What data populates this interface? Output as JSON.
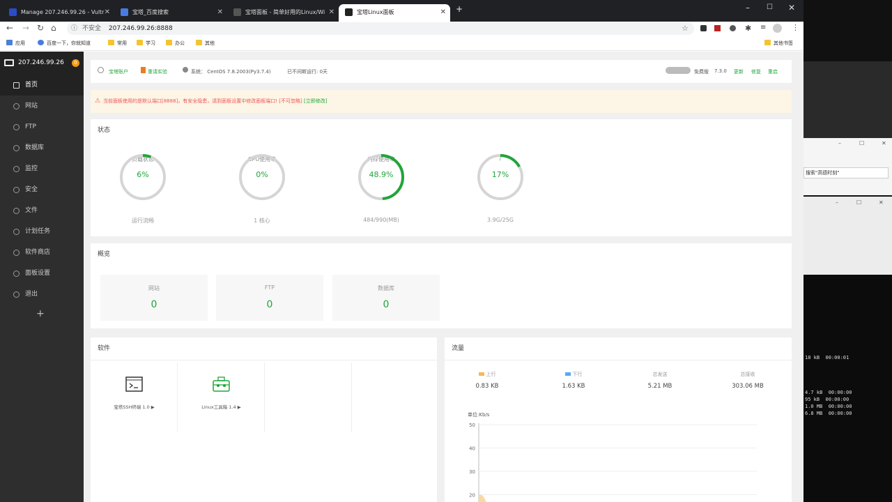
{
  "browser": {
    "tabs": [
      {
        "title": "Manage 207.246.99.26 - Vultr",
        "icon_color": "#2b4cc7"
      },
      {
        "title": "宝塔_百度搜索",
        "icon_color": "#4a7be0"
      },
      {
        "title": "宝塔面板 - 简单好用的Linux/Wi",
        "icon_color": "#333"
      },
      {
        "title": "宝塔Linux面板",
        "icon_color": "#333"
      }
    ],
    "address_security": "不安全",
    "address_url": "207.246.99.26:8888",
    "bookmarks": [
      "应用",
      "百度一下，你就知道",
      "常用",
      "学习",
      "办公",
      "其他"
    ],
    "other_bookmarks": "其他书签"
  },
  "sidebar": {
    "server_ip": "207.246.99.26",
    "badge": "0",
    "items": [
      {
        "label": "首页",
        "icon": "home-icon"
      },
      {
        "label": "网站",
        "icon": "globe-icon"
      },
      {
        "label": "FTP",
        "icon": "ftp-icon"
      },
      {
        "label": "数据库",
        "icon": "database-icon"
      },
      {
        "label": "监控",
        "icon": "monitor-icon"
      },
      {
        "label": "安全",
        "icon": "shield-icon"
      },
      {
        "label": "文件",
        "icon": "folder-icon"
      },
      {
        "label": "计划任务",
        "icon": "clock-icon"
      },
      {
        "label": "软件商店",
        "icon": "store-icon"
      },
      {
        "label": "面板设置",
        "icon": "gear-icon"
      },
      {
        "label": "退出",
        "icon": "logout-icon"
      }
    ],
    "add": "+"
  },
  "topbar": {
    "account": "宝塔账户",
    "notice": "重请实验",
    "system": "系统：  CentOS 7.8.2003(Py3.7.4)",
    "uptime": "已不间断运行: 0天",
    "edition": "免费版",
    "version": "7.3.0",
    "update": "更新",
    "repair": "修复",
    "restart": "重启"
  },
  "warning": {
    "text": "当前面板使用的是默认端口[8888]，有安全隐患，请到面板设置中修改面板端口! [不可忽略]",
    "link": "[立即修改]"
  },
  "status": {
    "title": "状态",
    "gauges": [
      {
        "label": "负载状态",
        "value": "6%",
        "percent": 6,
        "sub": "运行流畅"
      },
      {
        "label": "CPU使用率",
        "value": "0%",
        "percent": 0,
        "sub": "1 核心"
      },
      {
        "label": "内存使用率",
        "value": "48.9%",
        "percent": 48.9,
        "sub": "484/990(MB)"
      },
      {
        "label": "/",
        "value": "17%",
        "percent": 17,
        "sub": "3.9G/25G"
      }
    ]
  },
  "overview": {
    "title": "概览",
    "cards": [
      {
        "label": "网站",
        "value": "0"
      },
      {
        "label": "FTP",
        "value": "0"
      },
      {
        "label": "数据库",
        "value": "0"
      }
    ]
  },
  "software": {
    "title": "软件",
    "items": [
      {
        "name": "宝塔SSH终端 1.0 ▶",
        "icon": "terminal-icon"
      },
      {
        "name": "Linux工具箱 1.4 ▶",
        "icon": "toolbox-icon"
      }
    ]
  },
  "traffic": {
    "title": "流量",
    "cols": [
      {
        "label": "上行",
        "value": "0.83 KB",
        "color": "#f7b851"
      },
      {
        "label": "下行",
        "value": "1.63 KB",
        "color": "#52a9ff"
      },
      {
        "label": "总发送",
        "value": "5.21 MB"
      },
      {
        "label": "总接收",
        "value": "303.06 MB"
      }
    ],
    "unit": "单位:Kb/s",
    "yticks": [
      "50",
      "40",
      "30",
      "20"
    ]
  },
  "desktop": {
    "search_text": "搜索\"高德时刻\"",
    "terminal_lines": [
      "18 kB  00:00:01",
      "4.7 kB  00:00:00",
      "95 kB  00:00:00",
      "1.0 MB  00:00:00",
      "6.8 MB  00:00:00"
    ]
  },
  "status_link": "javascript:;"
}
